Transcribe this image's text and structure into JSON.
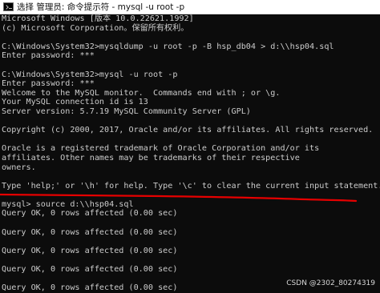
{
  "window": {
    "title": "选择 管理员: 命令提示符 - mysql  -u root -p",
    "icon": "cmd-icon"
  },
  "console": {
    "lines": [
      "Microsoft Windows [版本 10.0.22621.1992]",
      "(c) Microsoft Corporation。保留所有权利。",
      "",
      "C:\\Windows\\System32>mysqldump -u root -p -B hsp_db04 > d:\\\\hsp04.sql",
      "Enter password: ***",
      "",
      "C:\\Windows\\System32>mysql -u root -p",
      "Enter password: ***",
      "Welcome to the MySQL monitor.  Commands end with ; or \\g.",
      "Your MySQL connection id is 13",
      "Server version: 5.7.19 MySQL Community Server (GPL)",
      "",
      "Copyright (c) 2000, 2017, Oracle and/or its affiliates. All rights reserved.",
      "",
      "Oracle is a registered trademark of Oracle Corporation and/or its",
      "affiliates. Other names may be trademarks of their respective",
      "owners.",
      "",
      "Type 'help;' or '\\h' for help. Type '\\c' to clear the current input statement.",
      "",
      "mysql> source d:\\\\hsp04.sql",
      "Query OK, 0 rows affected (0.00 sec)",
      "",
      "Query OK, 0 rows affected (0.00 sec)",
      "",
      "Query OK, 0 rows affected (0.00 sec)",
      "",
      "Query OK, 0 rows affected (0.00 sec)",
      "",
      "Query OK, 0 rows affected (0.00 sec)"
    ]
  },
  "annotation": {
    "color": "#e60000"
  },
  "watermark": "CSDN @2302_80274319",
  "colors": {
    "background": "#0c0c0c",
    "text": "#cccccc",
    "titlebar": "#ffffff"
  }
}
